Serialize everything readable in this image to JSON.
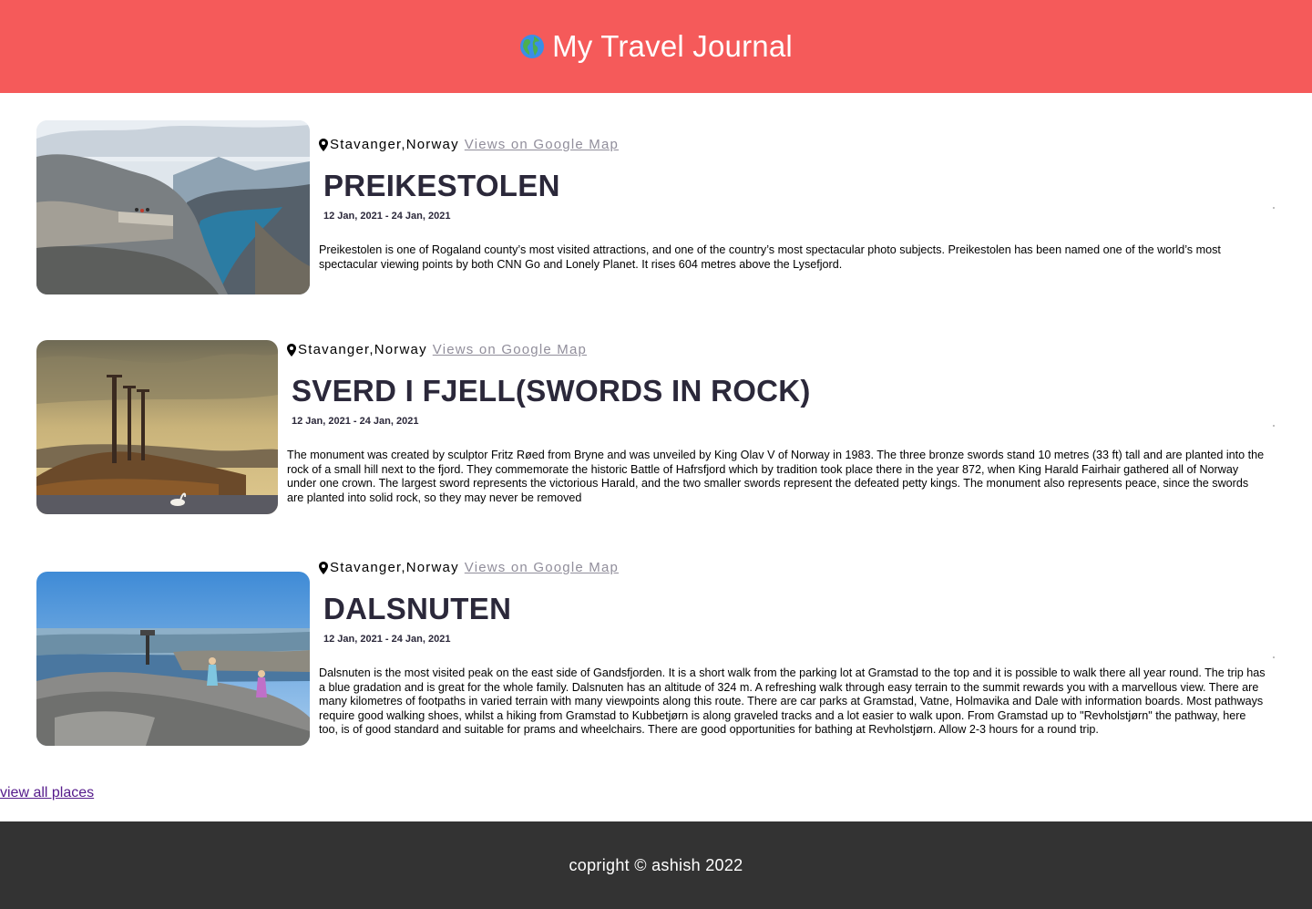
{
  "header": {
    "title": "My Travel Journal",
    "icon": "globe-icon",
    "bg_color": "#f55a5a"
  },
  "entries": [
    {
      "location": "Stavanger,Norway",
      "map_link": "Views on Google Map",
      "title": "PREIKESTOLEN",
      "dates": "12 Jan, 2021 - 24 Jan, 2021",
      "description": "Preikestolen is one of Rogaland county’s most visited attractions, and one of the country’s most spectacular photo subjects. Preikestolen has been named one of the world’s most spectacular viewing points by both CNN Go and Lonely Planet. It rises 604 metres above the Lysefjord."
    },
    {
      "location": "Stavanger,Norway",
      "map_link": "Views on Google Map",
      "title": "SVERD I FJELL(SWORDS IN ROCK)",
      "dates": "12 Jan, 2021 - 24 Jan, 2021",
      "description": "The monument was created by sculptor Fritz Røed from Bryne and was unveiled by King Olav V of Norway in 1983. The three bronze swords stand 10 metres (33 ft) tall and are planted into the rock of a small hill next to the fjord. They commemorate the historic Battle of Hafrsfjord which by tradition took place there in the year 872, when King Harald Fairhair gathered all of Norway under one crown. The largest sword represents the victorious Harald, and the two smaller swords represent the defeated petty kings. The monument also represents peace, since the swords are planted into solid rock, so they may never be removed"
    },
    {
      "location": "Stavanger,Norway",
      "map_link": "Views on Google Map",
      "title": "DALSNUTEN",
      "dates": "12 Jan, 2021 - 24 Jan, 2021",
      "description": "Dalsnuten is the most visited peak on the east side of Gandsfjorden. It is a short walk from the parking lot at Gramstad to the top and it is possible to walk there all year round. The trip has a blue gradation and is great for the whole family. Dalsnuten has an altitude of 324 m. A refreshing walk through easy terrain to the summit rewards you with a marvellous view. There are many kilometres of footpaths in varied terrain with many viewpoints along this route. There are car parks at Gramstad, Vatne, Holmavika and Dale with information boards. Most pathways require good walking shoes, whilst a hiking from Gramstad to Kubbetjørn is along graveled tracks and a lot easier to walk upon. From Gramstad up to \"Revholstjørn\" the pathway, here too, is of good standard and suitable for prams and wheelchairs. There are good opportunities for bathing at Revholstjørn. Allow 2-3 hours for a round trip."
    }
  ],
  "view_all": "view all places",
  "footer": {
    "text": "copright © ashish 2022",
    "bg_color": "#333333"
  }
}
